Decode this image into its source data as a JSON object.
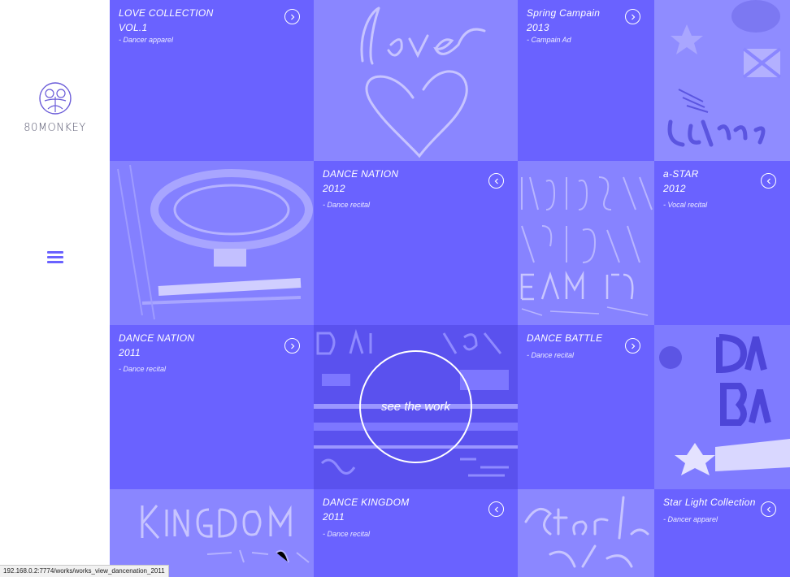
{
  "brand": {
    "name": "80MONKEY",
    "accent": "#6a62ff"
  },
  "menu": {
    "icon": "hamburger-icon"
  },
  "works": [
    {
      "title": "LOVE COLLECTION\nVOL.1",
      "category": "- Dancer apparel"
    },
    {
      "title": "Spring Campain\n2013",
      "category": "- Campain Ad"
    },
    {
      "title": "DANCE NATION\n2012",
      "category": "- Dance recital"
    },
    {
      "title": "a-STAR\n2012",
      "category": "- Vocal recital"
    },
    {
      "title": "DANCE NATION\n2011",
      "category": "- Dance recital"
    },
    {
      "title": "DANCE BATTLE",
      "category": "- Dance recital"
    },
    {
      "title": "DANCE KINGDOM\n2011",
      "category": "- Dance recital"
    },
    {
      "title": "Star Light Collection",
      "category": "- Dancer apparel"
    }
  ],
  "hover": {
    "label": "see the work"
  },
  "status": {
    "url": "192.168.0.2:7774/works/works_view_dancenation_2011"
  }
}
